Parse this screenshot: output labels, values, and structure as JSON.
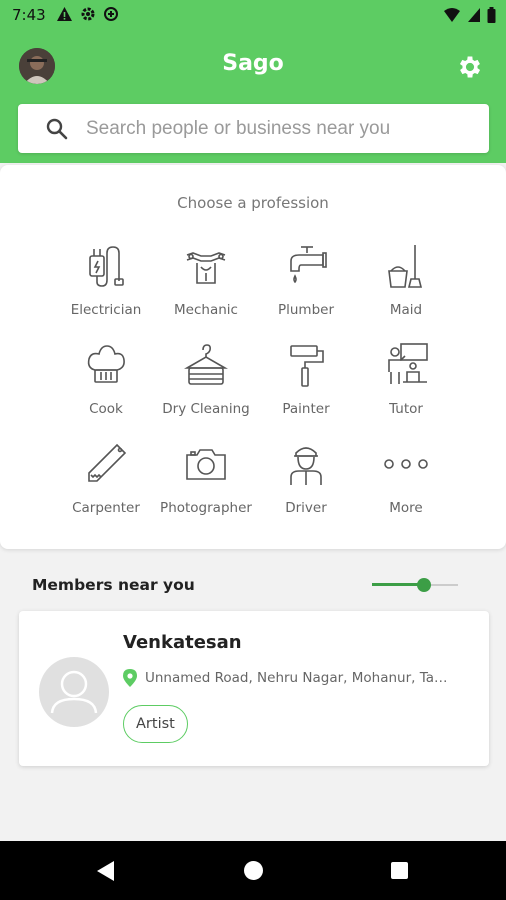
{
  "status_bar": {
    "time": "7:43",
    "left_icons": [
      "warning-icon",
      "settings-icon",
      "data-saver-icon"
    ],
    "right_icons": [
      "wifi-icon",
      "signal-icon",
      "battery-icon"
    ]
  },
  "app_bar": {
    "title": "Sago",
    "settings_icon": "gear-icon",
    "accent_color": "#5dcc63"
  },
  "search": {
    "placeholder": "Search people or business near you",
    "value": ""
  },
  "professions": {
    "title": "Choose a profession",
    "items": [
      {
        "label": "Electrician",
        "icon": "electric-plug-icon"
      },
      {
        "label": "Mechanic",
        "icon": "mechanic-icon"
      },
      {
        "label": "Plumber",
        "icon": "faucet-icon"
      },
      {
        "label": "Maid",
        "icon": "mop-bucket-icon"
      },
      {
        "label": "Cook",
        "icon": "chef-hat-icon"
      },
      {
        "label": "Dry Cleaning",
        "icon": "hanger-icon"
      },
      {
        "label": "Painter",
        "icon": "paint-roller-icon"
      },
      {
        "label": "Tutor",
        "icon": "tutor-icon"
      },
      {
        "label": "Carpenter",
        "icon": "saw-icon"
      },
      {
        "label": "Photographer",
        "icon": "camera-icon"
      },
      {
        "label": "Driver",
        "icon": "driver-icon"
      },
      {
        "label": "More",
        "icon": "more-dots-icon"
      }
    ]
  },
  "members": {
    "title": "Members near you",
    "distance_slider_fraction": 0.6,
    "list": [
      {
        "name": "Venkatesan",
        "address": "Unnamed Road, Nehru Nagar, Mohanur, Tamil Nadu",
        "tag": "Artist"
      }
    ]
  },
  "nav_bar": {
    "buttons": [
      "back-icon",
      "home-icon",
      "recents-icon"
    ]
  }
}
